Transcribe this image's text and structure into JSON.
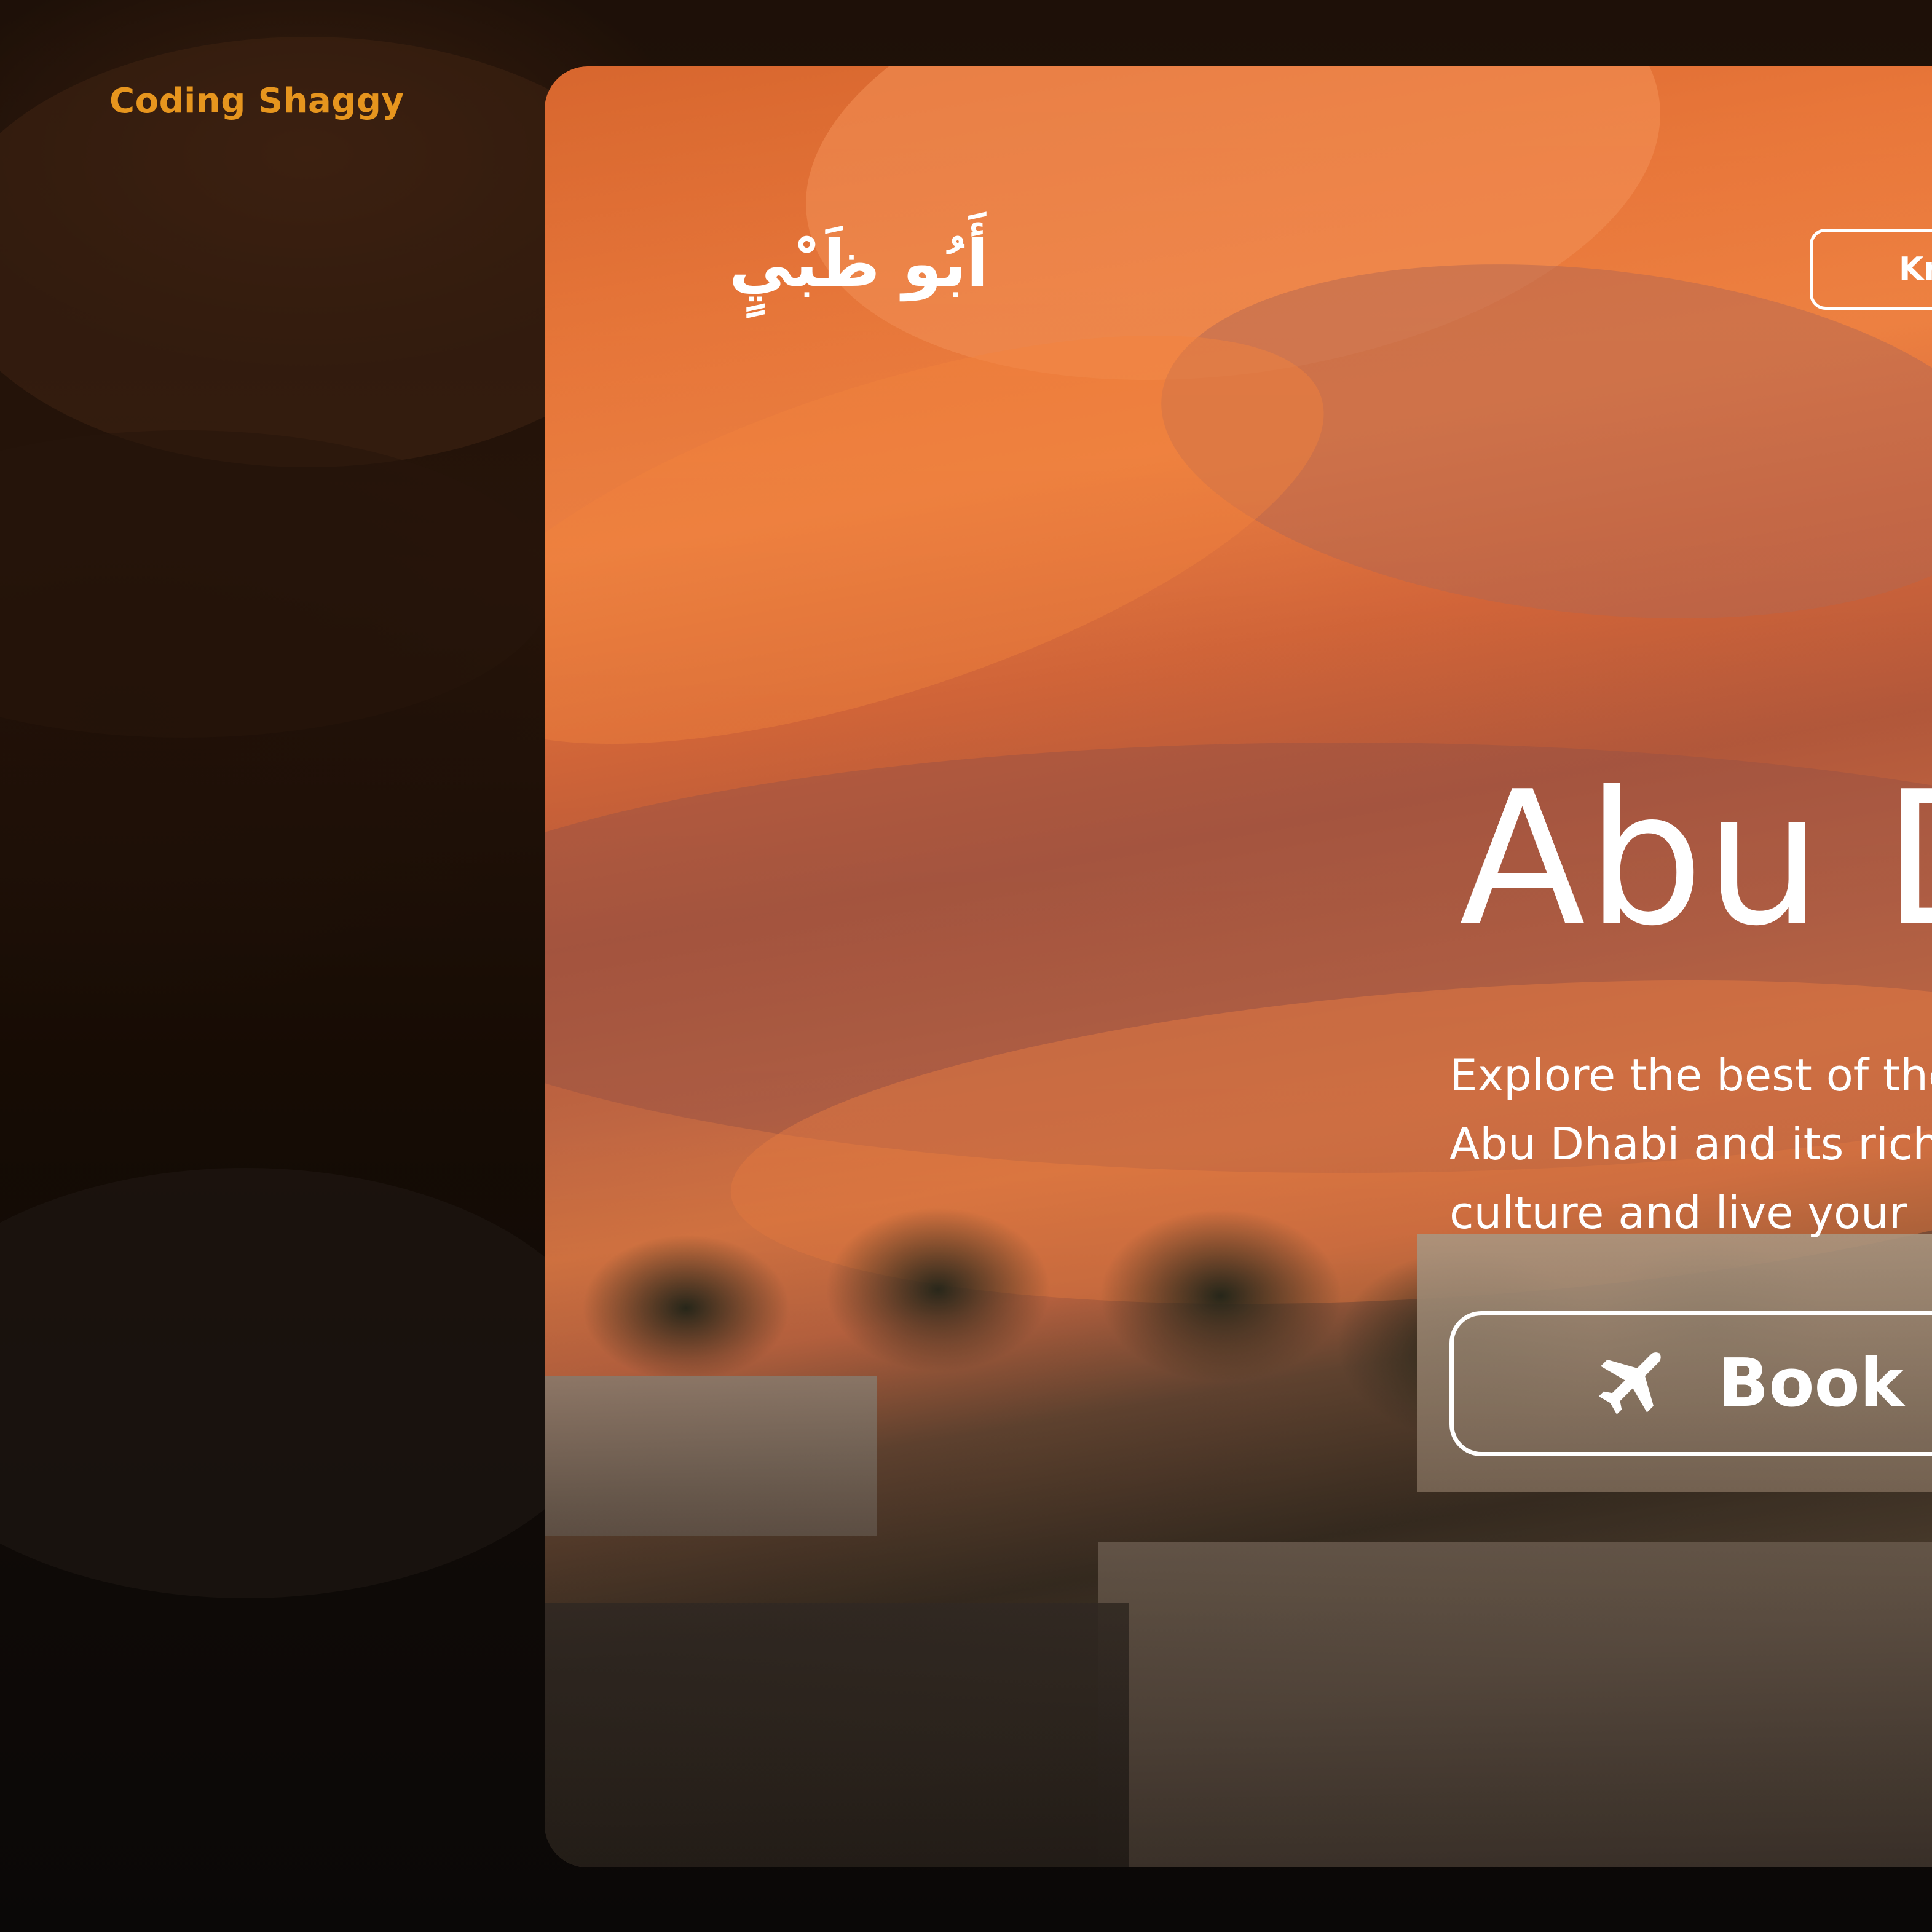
{
  "brand": {
    "name": "Coding Shaggy"
  },
  "hero": {
    "arabic_name": "أَبُو ظَبْيٍ",
    "know_button_label": "Kn",
    "title": "Abu D",
    "description_lines": [
      "Explore the best of the",
      "Abu Dhabi and its rich",
      "culture  and live your"
    ],
    "book_button_label": "Book",
    "book_icon": "airplane-icon"
  },
  "colors": {
    "brand_accent": "#e6951e",
    "text_on_image": "#ffffff",
    "page_background": "#2a160b"
  }
}
